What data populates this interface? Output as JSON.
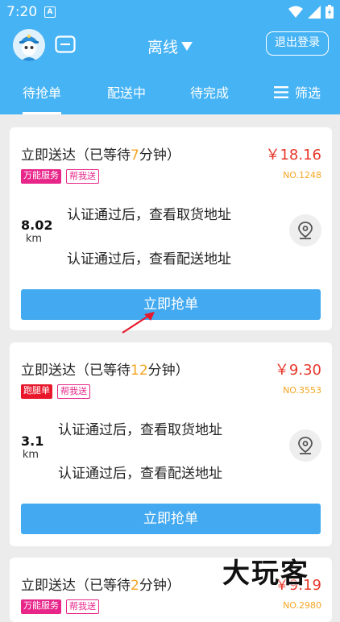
{
  "statusbar": {
    "time": "7:20",
    "app_icon_letter": "A"
  },
  "header": {
    "status_label": "离线",
    "logout_label": "退出登录"
  },
  "tabs": [
    {
      "label": "待抢单",
      "active": true
    },
    {
      "label": "配送中",
      "active": false
    },
    {
      "label": "待完成",
      "active": false
    },
    {
      "label": "筛选",
      "active": false
    }
  ],
  "orders": [
    {
      "title_prefix": "立即送达（已等待",
      "wait": "7",
      "title_suffix": "分钟）",
      "price": "￥18.16",
      "tags": [
        "万能服务",
        "帮我送"
      ],
      "no": "NO.1248",
      "distance": "8.02",
      "unit": "km",
      "pickup": "认证通过后，查看取货地址",
      "delivery": "认证通过后，查看配送地址",
      "button": "立即抢单"
    },
    {
      "title_prefix": "立即送达（已等待",
      "wait": "12",
      "title_suffix": "分钟）",
      "price": "￥9.30",
      "tags": [
        "跑腿单",
        "帮我送"
      ],
      "no": "NO.3553",
      "distance": "3.1",
      "unit": "km",
      "pickup": "认证通过后，查看取货地址",
      "delivery": "认证通过后，查看配送地址",
      "button": "立即抢单"
    },
    {
      "title_prefix": "立即送达（已等待",
      "wait": "2",
      "title_suffix": "分钟）",
      "price": "￥9.19",
      "tags": [
        "万能服务",
        "帮我送"
      ],
      "no": "NO.2980"
    }
  ],
  "watermark": "大玩客",
  "colors": {
    "header": "#46b3f5",
    "button": "#43a9f0",
    "price": "#e8372b",
    "wait": "#f5a623",
    "tag_pink": "#e8268a",
    "tag_red": "#e8172b",
    "arrow": "#e8172b"
  }
}
